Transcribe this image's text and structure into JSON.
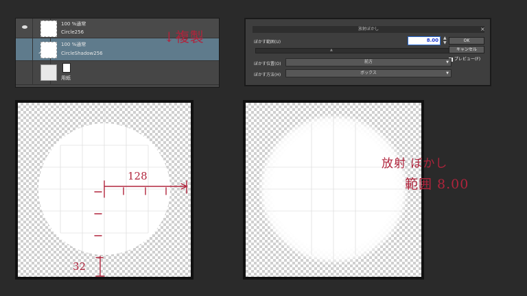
{
  "layers": [
    {
      "blend": "100 %通常",
      "name": "Circle256"
    },
    {
      "blend": "100 %通常",
      "name": "CircleShadow256"
    },
    {
      "name": "用紙"
    }
  ],
  "layer_note": "↓複製",
  "dialog": {
    "title": "放射ぼかし",
    "blur_range_label": "ぼかす範囲(U)",
    "blur_range_value": "8.00",
    "ok_label": "OK",
    "cancel_label": "キャンセル",
    "preview_label": "プレビュー(F)",
    "blur_position_label": "ぼかす位置(O)",
    "blur_position_value": "前方",
    "blur_method_label": "ぼかす方法(H)",
    "blur_method_value": "ボックス"
  },
  "annotations": {
    "radius": "128",
    "step": "32",
    "blur_note_line1": "放射 ぼかし",
    "blur_note_line2": "範囲 8.00"
  },
  "colors": {
    "annotation": "#b0243c",
    "panel": "#464646",
    "selected_layer": "#5f7b8c",
    "background": "#2a2a2a"
  }
}
